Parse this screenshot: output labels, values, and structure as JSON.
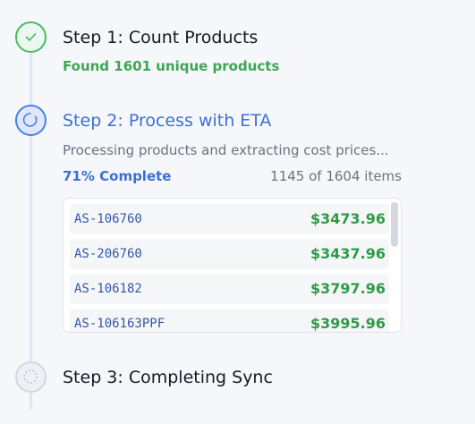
{
  "steps": [
    {
      "title": "Step 1: Count Products",
      "status": "complete",
      "detail": "Found 1601 unique products",
      "icon": "check-icon"
    },
    {
      "title": "Step 2: Process with ETA",
      "status": "in-progress",
      "detail": "Processing products and extracting cost prices...",
      "icon": "spinner-icon",
      "progress": {
        "percent_label": "71% Complete",
        "count_label": "1145 of 1604 items",
        "percent": 71,
        "processed": 1145,
        "total": 1604
      },
      "items": [
        {
          "sku": "AS-106760",
          "price": "$3473.96"
        },
        {
          "sku": "AS-206760",
          "price": "$3437.96"
        },
        {
          "sku": "AS-106182",
          "price": "$3797.96"
        },
        {
          "sku": "AS-106163PPF",
          "price": "$3995.96"
        }
      ]
    },
    {
      "title": "Step 3: Completing Sync",
      "status": "pending",
      "icon": "pending-circle-icon"
    }
  ],
  "colors": {
    "success": "#46bb5d",
    "active": "#4a7fe6",
    "pending": "#d2d7e2",
    "price": "#2f9a47"
  }
}
